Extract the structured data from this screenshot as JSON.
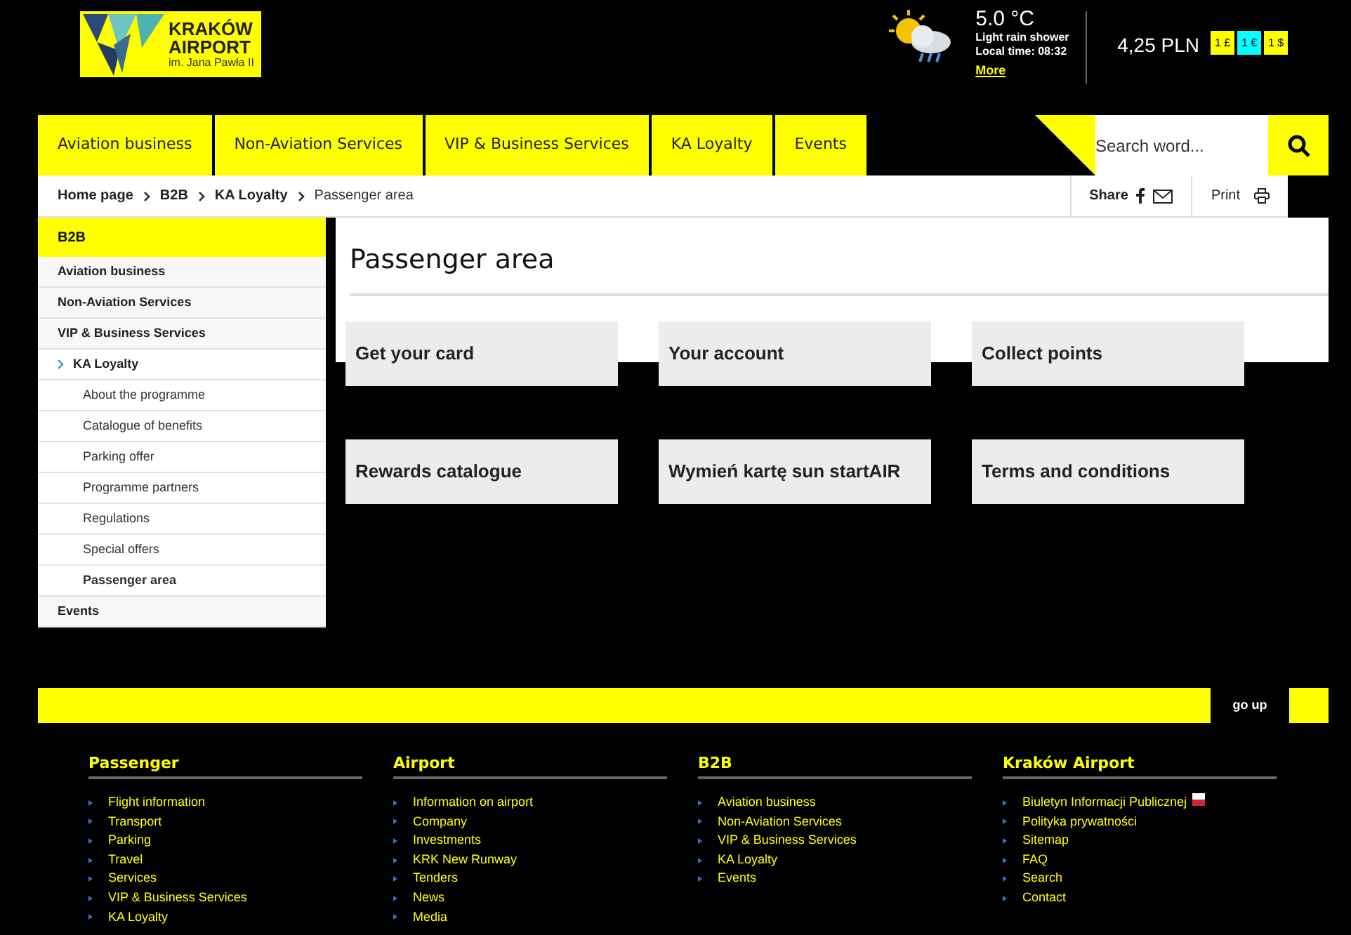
{
  "logo": {
    "name": "KRAKÓW",
    "name_2": "AIRPORT",
    "subtitle": "im. Jana Pawła II"
  },
  "weather": {
    "temperature": "5.0 °C",
    "condition": "Light rain shower",
    "local_time": "Local time: 08:32",
    "link": "More"
  },
  "currency": {
    "rate": "4,25 PLN",
    "options": [
      {
        "label": "1 £",
        "selected": false
      },
      {
        "label": "1 €",
        "selected": true
      },
      {
        "label": "1 $",
        "selected": false
      }
    ]
  },
  "nav": [
    "Aviation business",
    "Non-Aviation Services",
    "VIP & Business Services",
    "KA Loyalty",
    "Events"
  ],
  "search": {
    "placeholder": "Search word..."
  },
  "breadcrumb": [
    "Home page",
    "B2B",
    "KA Loyalty",
    "Passenger area"
  ],
  "share": "Share",
  "print": "Print",
  "sidebar": {
    "title": "B2B",
    "items": [
      {
        "label": "Aviation business",
        "expanded": false
      },
      {
        "label": "Non-Aviation Services",
        "expanded": false
      },
      {
        "label": "VIP & Business Services",
        "expanded": false
      },
      {
        "label": "KA Loyalty",
        "expanded": true,
        "children": [
          {
            "label": "About the programme",
            "selected": false
          },
          {
            "label": "Catalogue of benefits",
            "selected": false
          },
          {
            "label": "Parking offer",
            "selected": false
          },
          {
            "label": "Programme partners",
            "selected": false
          },
          {
            "label": "Regulations",
            "selected": false
          },
          {
            "label": "Special offers",
            "selected": false
          },
          {
            "label": "Passenger area",
            "selected": true
          }
        ]
      },
      {
        "label": "Events",
        "expanded": false
      }
    ]
  },
  "page_title": "Passenger area",
  "tiles": [
    "Get your card",
    "Your account",
    "Collect points",
    "Rewards catalogue",
    "Wymień kartę sun startAIR",
    "Terms and conditions"
  ],
  "go_up": "go up",
  "footer_columns": [
    {
      "title": "Passenger",
      "links": [
        {
          "label": "Flight information"
        },
        {
          "label": "Transport"
        },
        {
          "label": "Parking"
        },
        {
          "label": "Travel"
        },
        {
          "label": "Services"
        },
        {
          "label": "VIP & Business Services"
        },
        {
          "label": "KA Loyalty"
        }
      ]
    },
    {
      "title": "Airport",
      "links": [
        {
          "label": "Information on airport"
        },
        {
          "label": "Company"
        },
        {
          "label": "Investments"
        },
        {
          "label": "KRK New Runway"
        },
        {
          "label": "Tenders"
        },
        {
          "label": "News"
        },
        {
          "label": "Media"
        }
      ]
    },
    {
      "title": "B2B",
      "links": [
        {
          "label": "Aviation business"
        },
        {
          "label": "Non-Aviation Services"
        },
        {
          "label": "VIP & Business Services"
        },
        {
          "label": "KA Loyalty"
        },
        {
          "label": "Events"
        }
      ]
    },
    {
      "title": "Kraków Airport",
      "links": [
        {
          "label": "Biuletyn Informacji Publicznej",
          "badge": true
        },
        {
          "label": "Polityka prywatności"
        },
        {
          "label": "Sitemap"
        },
        {
          "label": "FAQ"
        },
        {
          "label": "Search"
        },
        {
          "label": "Contact"
        }
      ]
    }
  ]
}
